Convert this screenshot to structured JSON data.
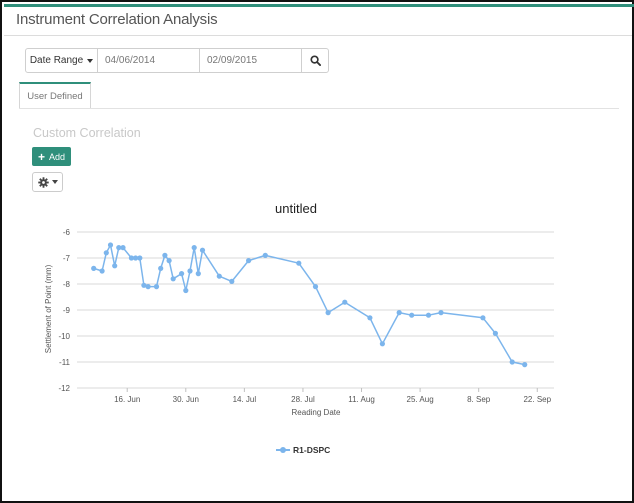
{
  "app": {
    "title": "Instrument Correlation Analysis"
  },
  "toolbar": {
    "range_label": "Date Range",
    "start_date": "04/06/2014",
    "end_date": "02/09/2015",
    "search_icon": "search-icon"
  },
  "tabs": [
    {
      "label": "User Defined",
      "active": true
    }
  ],
  "section": {
    "title": "Custom Correlation",
    "add_label": "Add",
    "add_icon": "plus-icon",
    "settings_icon": "gear-icon"
  },
  "colors": {
    "accent": "#2f8f7b",
    "series": "#7cb5ec"
  },
  "chart_data": {
    "type": "line",
    "title": "untitled",
    "xlabel": "Reading Date",
    "ylabel": "Settlement of Point (mm)",
    "ylim": [
      -12,
      -6
    ],
    "yticks": [
      -6,
      -7,
      -8,
      -9,
      -10,
      -11,
      -12
    ],
    "x_ticks": [
      {
        "date": "2014-06-16",
        "label": "16. Jun"
      },
      {
        "date": "2014-06-30",
        "label": "30. Jun"
      },
      {
        "date": "2014-07-14",
        "label": "14. Jul"
      },
      {
        "date": "2014-07-28",
        "label": "28. Jul"
      },
      {
        "date": "2014-08-11",
        "label": "11. Aug"
      },
      {
        "date": "2014-08-25",
        "label": "25. Aug"
      },
      {
        "date": "2014-09-08",
        "label": "8. Sep"
      },
      {
        "date": "2014-09-22",
        "label": "22. Sep"
      }
    ],
    "xlim": [
      "2014-06-04",
      "2014-09-26"
    ],
    "grid": true,
    "legend": "bottom-center",
    "series": [
      {
        "name": "R1-DSPC",
        "points": [
          [
            "2014-06-08",
            -7.4
          ],
          [
            "2014-06-10",
            -7.5
          ],
          [
            "2014-06-11",
            -6.8
          ],
          [
            "2014-06-12",
            -6.5
          ],
          [
            "2014-06-13",
            -7.3
          ],
          [
            "2014-06-14",
            -6.6
          ],
          [
            "2014-06-15",
            -6.6
          ],
          [
            "2014-06-17",
            -7.0
          ],
          [
            "2014-06-18",
            -7.0
          ],
          [
            "2014-06-19",
            -7.0
          ],
          [
            "2014-06-20",
            -8.05
          ],
          [
            "2014-06-21",
            -8.1
          ],
          [
            "2014-06-23",
            -8.1
          ],
          [
            "2014-06-24",
            -7.4
          ],
          [
            "2014-06-25",
            -6.9
          ],
          [
            "2014-06-26",
            -7.1
          ],
          [
            "2014-06-27",
            -7.8
          ],
          [
            "2014-06-29",
            -7.6
          ],
          [
            "2014-06-30",
            -8.25
          ],
          [
            "2014-07-01",
            -7.5
          ],
          [
            "2014-07-02",
            -6.6
          ],
          [
            "2014-07-03",
            -7.6
          ],
          [
            "2014-07-04",
            -6.7
          ],
          [
            "2014-07-08",
            -7.7
          ],
          [
            "2014-07-11",
            -7.9
          ],
          [
            "2014-07-15",
            -7.1
          ],
          [
            "2014-07-19",
            -6.9
          ],
          [
            "2014-07-27",
            -7.2
          ],
          [
            "2014-07-31",
            -8.1
          ],
          [
            "2014-08-03",
            -9.1
          ],
          [
            "2014-08-07",
            -8.7
          ],
          [
            "2014-08-13",
            -9.3
          ],
          [
            "2014-08-16",
            -10.3
          ],
          [
            "2014-08-20",
            -9.1
          ],
          [
            "2014-08-23",
            -9.2
          ],
          [
            "2014-08-27",
            -9.2
          ],
          [
            "2014-08-30",
            -9.1
          ],
          [
            "2014-09-09",
            -9.3
          ],
          [
            "2014-09-12",
            -9.9
          ],
          [
            "2014-09-16",
            -11.0
          ],
          [
            "2014-09-19",
            -11.1
          ]
        ]
      }
    ]
  }
}
